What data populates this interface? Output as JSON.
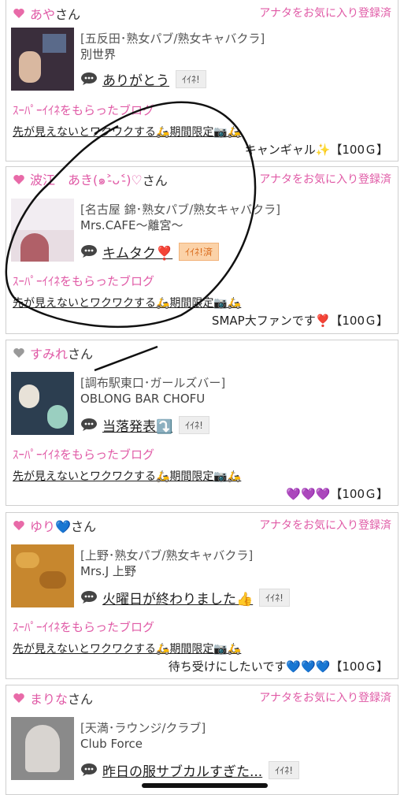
{
  "fav_label": "アナタをお気に入り登録済",
  "san": "さん",
  "super_label": "ｽｰﾊﾟｰｲｲﾈをもらったブログ",
  "entries": [
    {
      "name": "あや",
      "heart_color": "#e86aa8",
      "shop": "[五反田･熟女パブ/熟女キャバクラ]",
      "shop_name": "別世界",
      "post_title": "ありがとう",
      "iine": "ｲｲﾈ!",
      "iine_done": false,
      "blog": "先が見えないとワクワクする🛵期間限定📷🛵",
      "comment": "キャンギャル✨【100Ｇ】",
      "thumb_color": "#3a2e3c"
    },
    {
      "name": "波江　あき(๑˃̵ᴗ˂̵)♡",
      "heart_color": "#e86aa8",
      "shop": "[名古屋 錦･熟女パブ/熟女キャバクラ]",
      "shop_name": "Mrs.CAFE～離宮～",
      "post_title": "キムタク❣️",
      "iine": "ｲｲﾈ!済",
      "iine_done": true,
      "blog": "先が見えないとワクワクする🛵期間限定📷🛵",
      "comment": "SMAP大ファンです❣️【100Ｇ】",
      "thumb_color": "#d9c9d0"
    },
    {
      "name": "すみれ",
      "heart_color": "#999999",
      "shop": "[調布駅東口･ガールズバー]",
      "shop_name": "OBLONG BAR CHOFU",
      "post_title": "当落発表⤵️",
      "iine": "ｲｲﾈ!",
      "iine_done": false,
      "blog": "先が見えないとワクワクする🛵期間限定📷🛵",
      "comment": "💜💜💜【100Ｇ】",
      "thumb_color": "#2c3e50"
    },
    {
      "name": "ゆり💙",
      "heart_color": "#e86aa8",
      "shop": "[上野･熟女パブ/熟女キャバクラ]",
      "shop_name": "Mrs.J 上野",
      "post_title": "火曜日が終わりました👍",
      "iine": "ｲｲﾈ!",
      "iine_done": false,
      "blog": "先が見えないとワクワクする🛵期間限定📷🛵",
      "comment": "待ち受けにしたいです💙💙💙【100Ｇ】",
      "thumb_color": "#c7872e"
    },
    {
      "name": "まりな",
      "heart_color": "#e86aa8",
      "shop": "[天満･ラウンジ/クラブ]",
      "shop_name": "Club Force",
      "post_title": "昨日の服サブカルすぎた...",
      "iine": "ｲｲﾈ!",
      "iine_done": false,
      "blog": "",
      "comment": "",
      "thumb_color": "#8a8a8a"
    }
  ]
}
